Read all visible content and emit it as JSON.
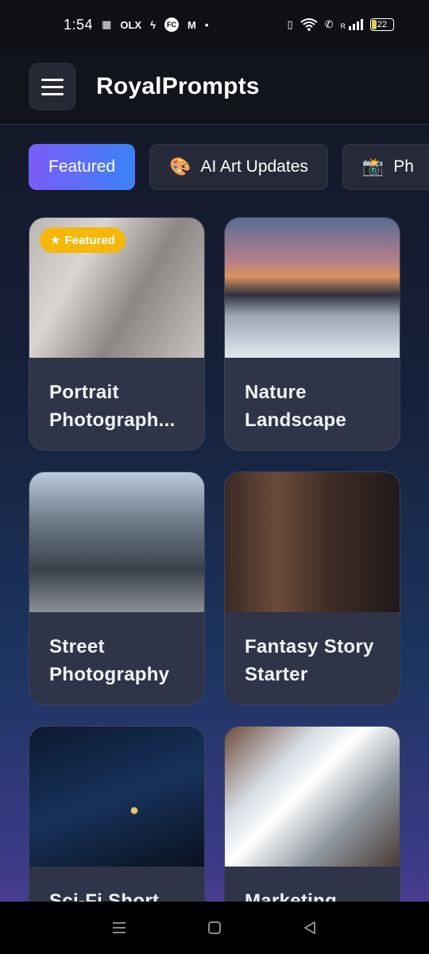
{
  "status_bar": {
    "time": "1:54",
    "icons": [
      "qr-icon",
      "olx-icon",
      "flash-icon",
      "fc-icon",
      "m-icon",
      "dot-icon",
      "vibrate-icon",
      "wifi-icon",
      "call-icon",
      "signal-icon"
    ],
    "olx_label": "OLX",
    "fc_label": "FC",
    "m_label": "M",
    "battery": "22",
    "signal_roaming": "R"
  },
  "header": {
    "title": "RoyalPrompts"
  },
  "tabs": [
    {
      "label": "Featured",
      "emoji": "",
      "active": true
    },
    {
      "label": "AI Art Updates",
      "emoji": "🎨",
      "active": false
    },
    {
      "label": "Ph",
      "emoji": "📸",
      "active": false
    }
  ],
  "cards": [
    {
      "title": "Portrait Photograph...",
      "badge": "Featured",
      "image": "portrait-photo"
    },
    {
      "title": "Nature Landscape",
      "badge": "",
      "image": "mountain-landscape"
    },
    {
      "title": "Street Photography",
      "badge": "",
      "image": "city-street"
    },
    {
      "title": "Fantasy Story Starter",
      "badge": "",
      "image": "library-shelves"
    },
    {
      "title": "Sci-Fi Short",
      "badge": "",
      "image": "earth-night-lights"
    },
    {
      "title": "Marketing",
      "badge": "",
      "image": "laptop-dashboard"
    }
  ],
  "colors": {
    "accent_start": "#7b5cf6",
    "accent_end": "#3b82f6",
    "badge": "#f5b70a"
  }
}
